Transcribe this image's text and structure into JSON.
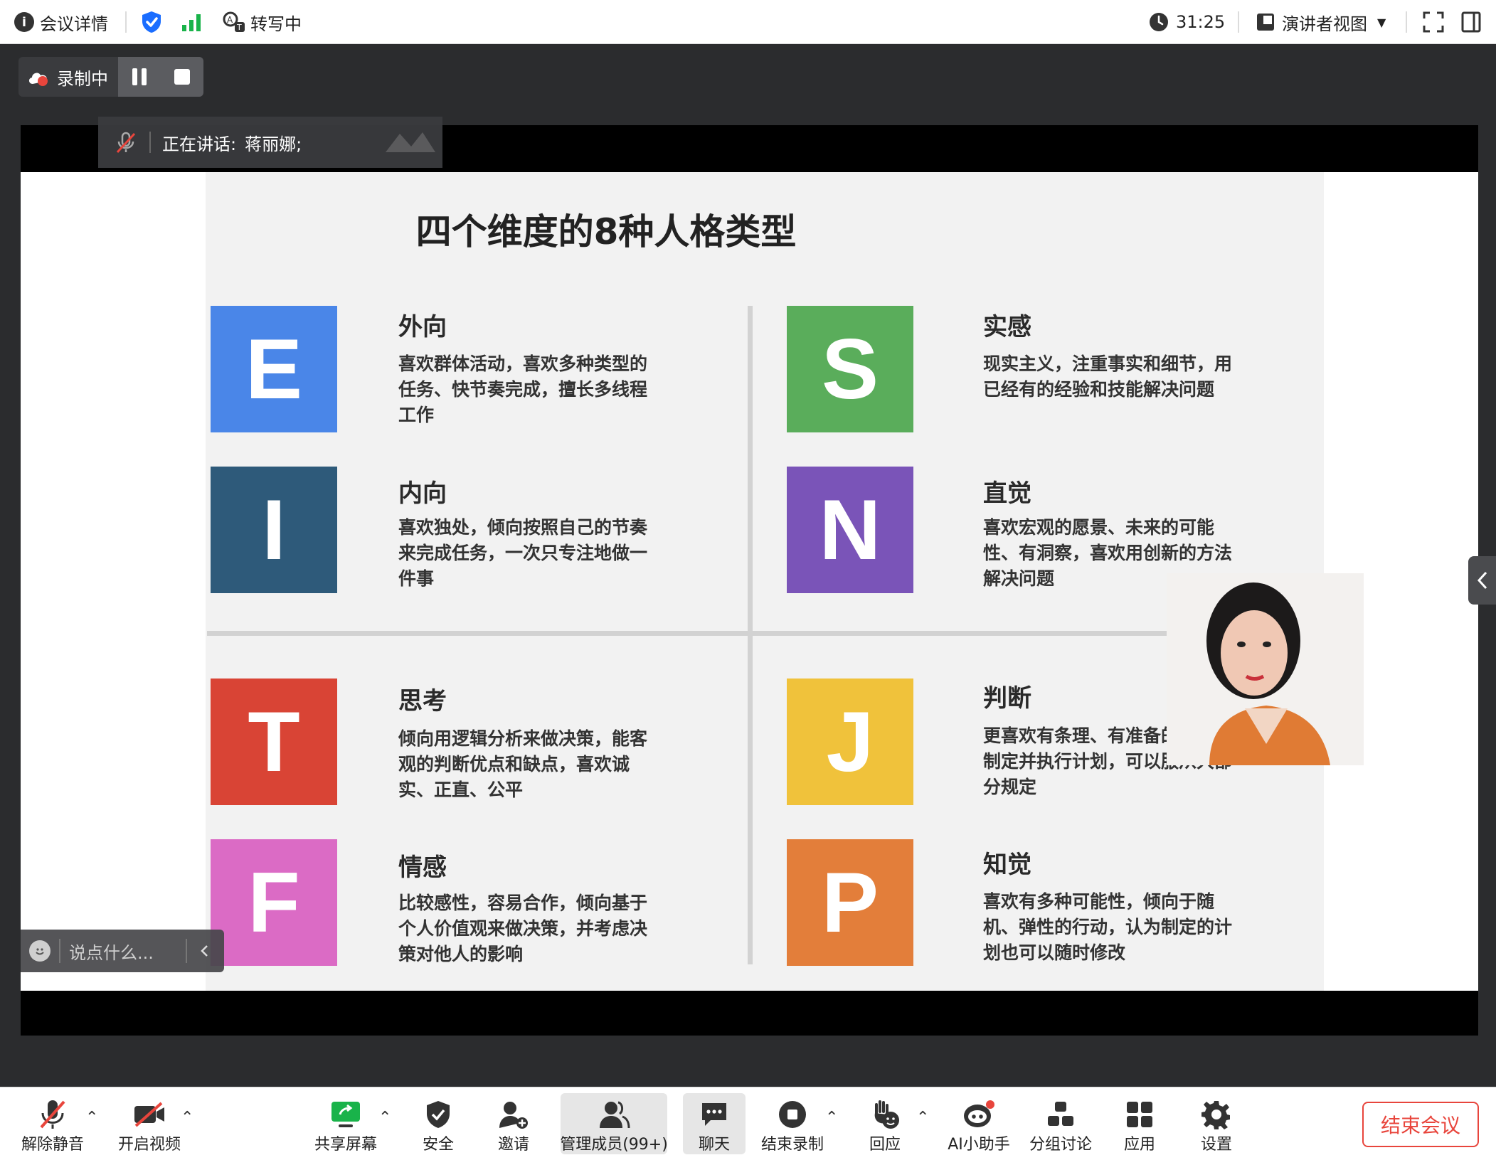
{
  "topbar": {
    "meeting_info": "会议详情",
    "transcribing": "转写中",
    "timer": "31:25",
    "view_mode": "演讲者视图"
  },
  "recording": {
    "label": "录制中"
  },
  "speaker": {
    "label": "正在讲话:",
    "name": "蒋丽娜;"
  },
  "slide": {
    "title": "四个维度的8种人格类型",
    "quadrants": [
      {
        "letter": "E",
        "color": "#4a86e8",
        "title": "外向",
        "desc": "喜欢群体活动，喜欢多种类型的任务、快节奏完成，擅长多线程工作"
      },
      {
        "letter": "S",
        "color": "#5aad5b",
        "title": "实感",
        "desc": "现实主义，注重事实和细节，用已经有的经验和技能解决问题"
      },
      {
        "letter": "I",
        "color": "#2e5a7a",
        "title": "内向",
        "desc": "喜欢独处，倾向按照自己的节奏来完成任务，一次只专注地做一件事"
      },
      {
        "letter": "N",
        "color": "#7a54b8",
        "title": "直觉",
        "desc": "喜欢宏观的愿景、未来的可能性、有洞察，喜欢用创新的方法解决问题"
      },
      {
        "letter": "T",
        "color": "#d94435",
        "title": "思考",
        "desc": "倾向用逻辑分析来做决策，能客观的判断优点和缺点，喜欢诚实、正直、公平"
      },
      {
        "letter": "J",
        "color": "#f0c23b",
        "title": "判断",
        "desc": "更喜欢有条理、有准备的，擅长制定并执行计划，可以服从大部分规定"
      },
      {
        "letter": "F",
        "color": "#db6bc5",
        "title": "情感",
        "desc": "比较感性，容易合作，倾向基于个人价值观来做决策，并考虑决策对他人的影响"
      },
      {
        "letter": "P",
        "color": "#e37e3a",
        "title": "知觉",
        "desc": "喜欢有多种可能性，倾向于随机、弹性的行动，认为制定的计划也可以随时修改"
      }
    ]
  },
  "chat": {
    "placeholder": "说点什么..."
  },
  "toolbar": {
    "items": [
      {
        "label": "解除静音"
      },
      {
        "label": "开启视频"
      },
      {
        "label": "共享屏幕"
      },
      {
        "label": "安全"
      },
      {
        "label": "邀请"
      },
      {
        "label": "管理成员(99+)"
      },
      {
        "label": "聊天"
      },
      {
        "label": "结束录制"
      },
      {
        "label": "回应"
      },
      {
        "label": "AI小助手"
      },
      {
        "label": "分组讨论"
      },
      {
        "label": "应用"
      },
      {
        "label": "设置"
      }
    ],
    "end_meeting": "结束会议"
  },
  "colors": {
    "accent_blue": "#1a6dff",
    "signal_green": "#19b34a",
    "danger_red": "#e8453c"
  }
}
